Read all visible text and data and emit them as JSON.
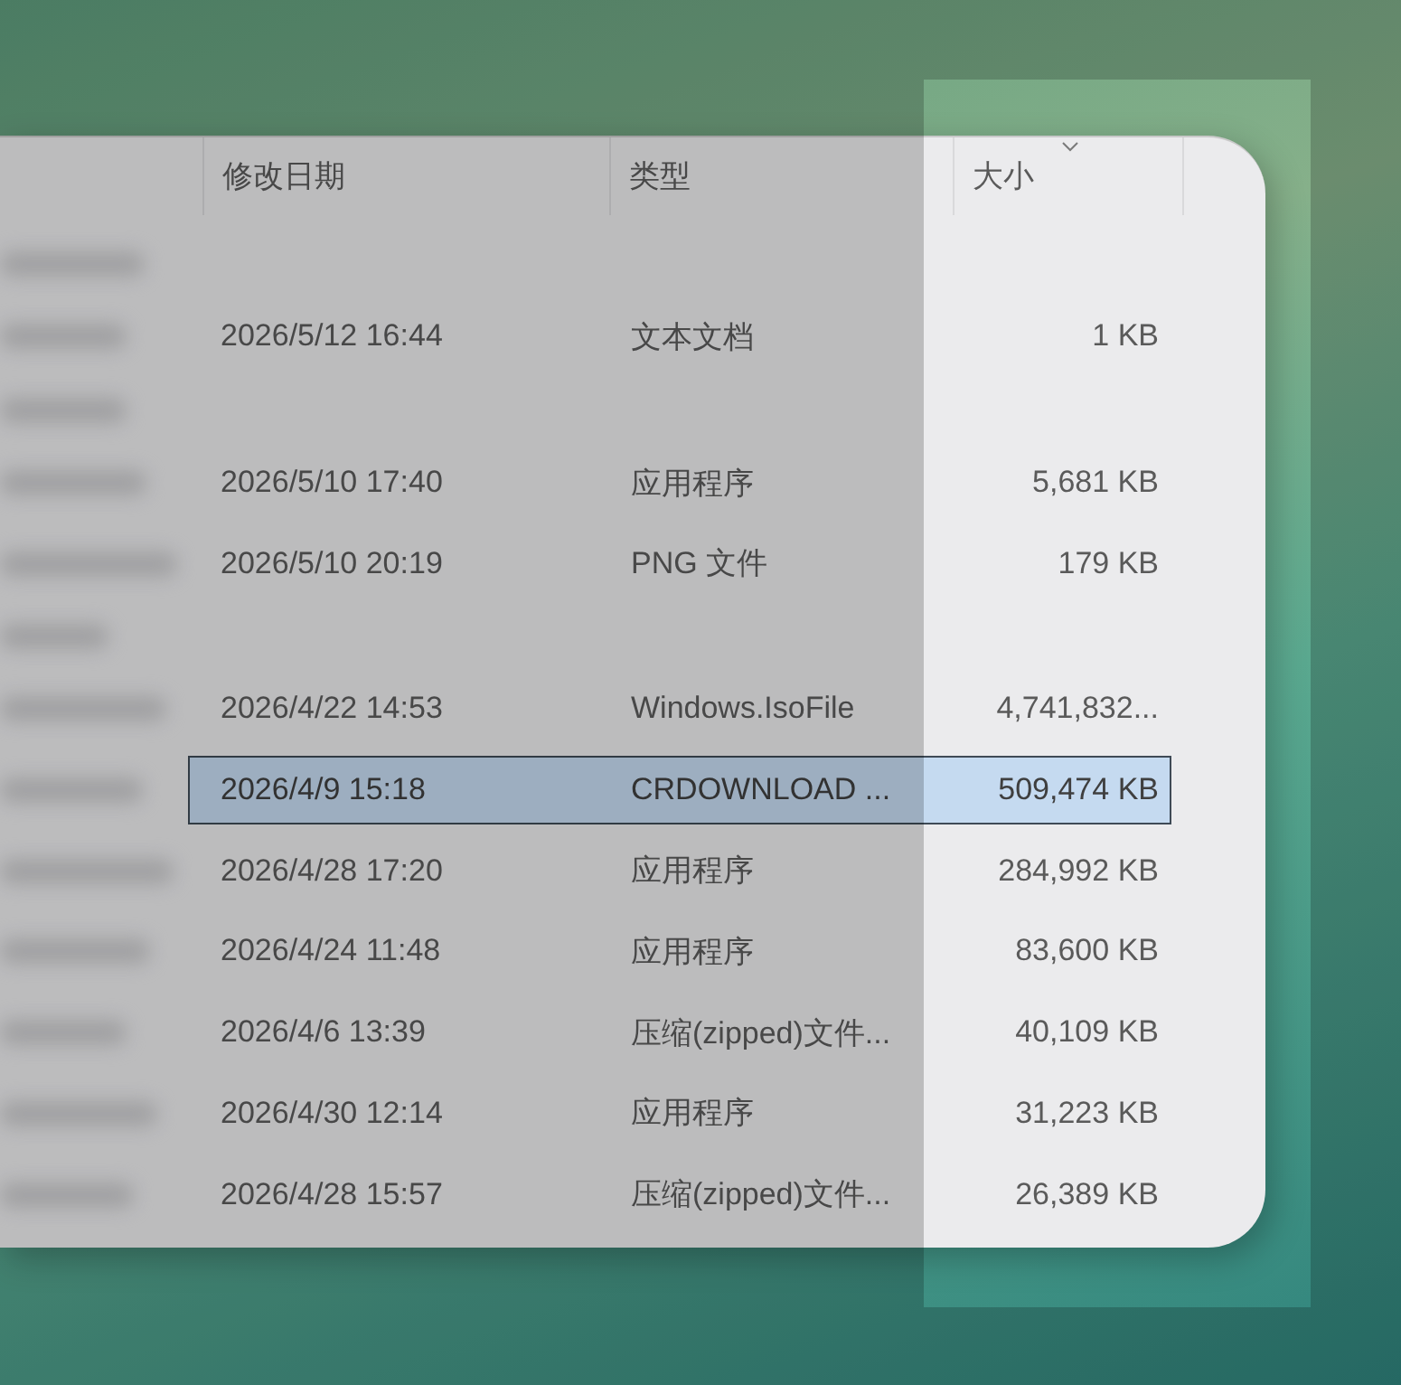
{
  "columns": [
    {
      "label": "修改日期",
      "sorted": false
    },
    {
      "label": "类型",
      "sorted": false
    },
    {
      "label": "大小",
      "sorted": true
    }
  ],
  "groups": [
    {
      "rows": [
        {
          "date": "2026/5/12 16:44",
          "type": "文本文档",
          "size": "1 KB",
          "selected": false
        }
      ]
    },
    {
      "rows": [
        {
          "date": "2026/5/10 17:40",
          "type": "应用程序",
          "size": "5,681 KB",
          "selected": false
        },
        {
          "date": "2026/5/10 20:19",
          "type": "PNG 文件",
          "size": "179 KB",
          "selected": false
        }
      ]
    },
    {
      "rows": [
        {
          "date": "2026/4/22 14:53",
          "type": "Windows.IsoFile",
          "size": "4,741,832...",
          "selected": false
        },
        {
          "date": "2026/4/9 15:18",
          "type": "CRDOWNLOAD ...",
          "size": "509,474 KB",
          "selected": true
        },
        {
          "date": "2026/4/28 17:20",
          "type": "应用程序",
          "size": "284,992 KB",
          "selected": false
        },
        {
          "date": "2026/4/24 11:48",
          "type": "应用程序",
          "size": "83,600 KB",
          "selected": false
        },
        {
          "date": "2026/4/6 13:39",
          "type": "压缩(zipped)文件...",
          "size": "40,109 KB",
          "selected": false
        },
        {
          "date": "2026/4/30 12:14",
          "type": "应用程序",
          "size": "31,223 KB",
          "selected": false
        },
        {
          "date": "2026/4/28 15:57",
          "type": "压缩(zipped)文件...",
          "size": "26,389 KB",
          "selected": false
        }
      ]
    }
  ]
}
